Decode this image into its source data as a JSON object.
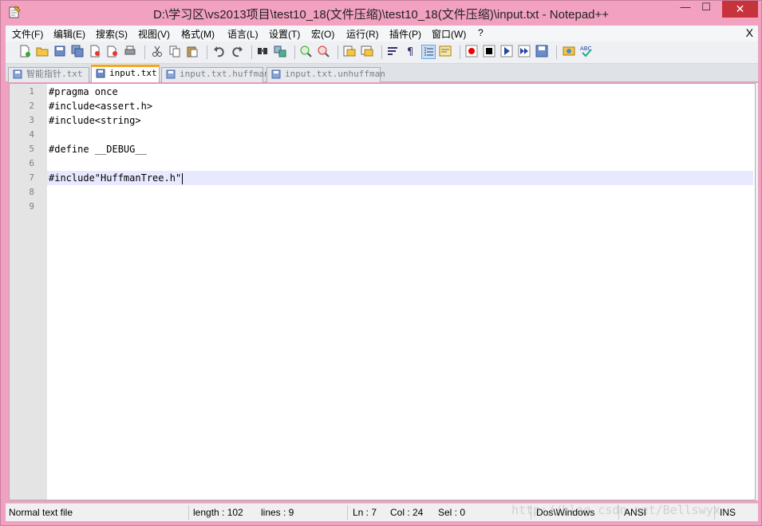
{
  "window": {
    "title": "D:\\学习区\\vs2013项目\\test10_18(文件压缩)\\test10_18(文件压缩)\\input.txt - Notepad++",
    "controls": {
      "minimize": "—",
      "maximize": "☐",
      "close": "✕"
    }
  },
  "menu": {
    "items": [
      "文件(F)",
      "编辑(E)",
      "搜索(S)",
      "视图(V)",
      "格式(M)",
      "语言(L)",
      "设置(T)",
      "宏(O)",
      "运行(R)",
      "插件(P)",
      "窗口(W)",
      "?"
    ],
    "close_doc": "X"
  },
  "toolbar": {
    "icons": [
      "new-file-icon",
      "open-file-icon",
      "save-icon",
      "save-all-icon",
      "close-icon",
      "close-all-icon",
      "print-icon",
      "cut-icon",
      "copy-icon",
      "paste-icon",
      "undo-icon",
      "redo-icon",
      "find-icon",
      "replace-icon",
      "zoom-in-icon",
      "zoom-out-icon",
      "sync-vertical-icon",
      "sync-horizontal-icon",
      "word-wrap-icon",
      "show-all-chars-icon",
      "indent-guide-icon",
      "document-map-icon",
      "record-macro-icon",
      "stop-record-icon",
      "play-macro-icon",
      "run-macro-multiple-icon",
      "save-macro-icon",
      "launch-browser-icon",
      "spell-check-icon"
    ],
    "spell_label": "ABC"
  },
  "tabs": [
    {
      "label": "智能指针.txt",
      "active": false
    },
    {
      "label": "input.txt",
      "active": true
    },
    {
      "label": "input.txt.huffman",
      "active": false
    },
    {
      "label": "input.txt.unhuffman",
      "active": false
    }
  ],
  "editor": {
    "lines": [
      {
        "num": "1",
        "text": "#pragma once"
      },
      {
        "num": "2",
        "text": "#include<assert.h>"
      },
      {
        "num": "3",
        "text": "#include<string>"
      },
      {
        "num": "4",
        "text": ""
      },
      {
        "num": "5",
        "text": "#define __DEBUG__"
      },
      {
        "num": "6",
        "text": ""
      },
      {
        "num": "7",
        "text": "#include\"HuffmanTree.h\""
      },
      {
        "num": "8",
        "text": ""
      },
      {
        "num": "9",
        "text": ""
      }
    ],
    "current_line": 7
  },
  "status": {
    "file_type": "Normal text file",
    "length": "length : 102",
    "lines": "lines : 9",
    "ln": "Ln : 7",
    "col": "Col : 24",
    "sel": "Sel : 0",
    "eol": "Dos\\Windows",
    "encoding": "ANSI",
    "mode": "INS"
  },
  "watermark": "http://blog.csdn.net/Bellswyx",
  "colors": {
    "titlebar": "#f2a1c1",
    "close_button": "#c7333a",
    "active_tab_accent": "#f5a623",
    "current_line": "#e8e8ff"
  }
}
